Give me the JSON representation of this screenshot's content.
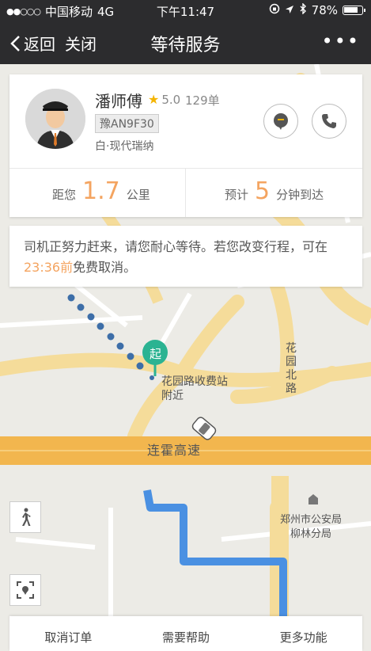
{
  "status_bar": {
    "signal": "●●○○○",
    "carrier": "中国移动",
    "network": "4G",
    "time": "下午11:47",
    "battery": "78%"
  },
  "nav": {
    "back_label": "返回",
    "close_label": "关闭",
    "title": "等待服务",
    "more_label": "•••"
  },
  "driver": {
    "name": "潘师傅",
    "rating": "5.0",
    "trips": "129单",
    "plate": "豫AN9F30",
    "car": "白·现代瑞纳"
  },
  "eta": {
    "distance_prefix": "距您",
    "distance_value": "1.7",
    "distance_unit": "公里",
    "time_prefix": "预计",
    "time_value": "5",
    "time_unit": "分钟到达"
  },
  "notice": {
    "text_part1": "司机正努力赶来，请您耐心等待。若您改变行程，可在",
    "highlight": "23:36前",
    "text_part2": "免费取消。"
  },
  "map": {
    "pickup_marker": "起",
    "pickup_label_line1": "花园路收费站",
    "pickup_label_line2": "附近",
    "road_highway": "连霍高速",
    "road_garden_north": "花园北路",
    "poi_police_line1": "郑州市公安局",
    "poi_police_line2": "柳林分局"
  },
  "bottom_bar": {
    "cancel_label": "取消订单",
    "help_label": "需要帮助",
    "more_label": "更多功能"
  },
  "colors": {
    "accent": "#f4a460",
    "route": "#4a90e2",
    "marker": "#2bb392",
    "road": "#f5dc9a"
  }
}
